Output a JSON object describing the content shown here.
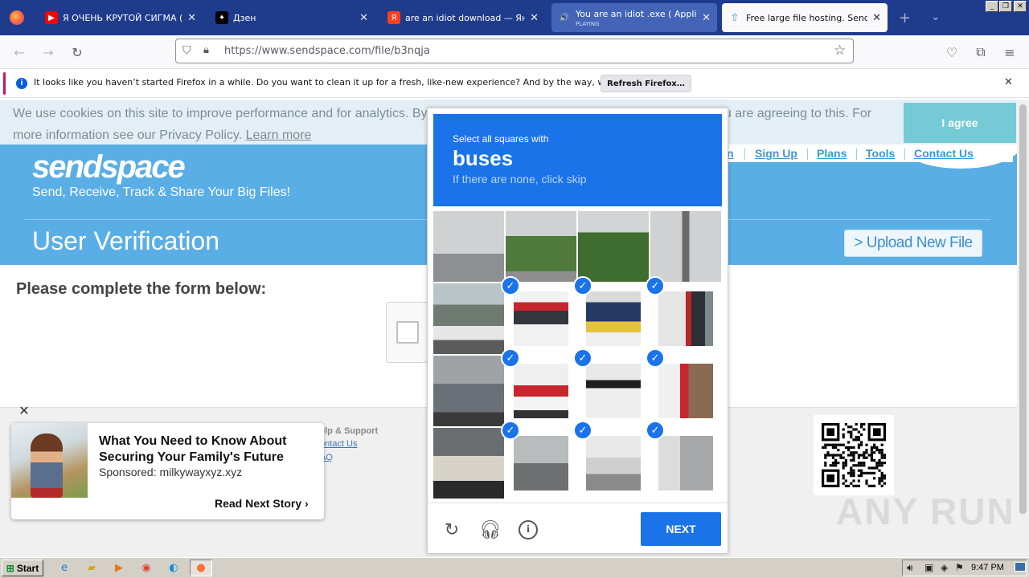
{
  "browser": {
    "tabs": [
      {
        "label": "Я ОЧЕНЬ КРУТОЙ СИГМА (PHONK)",
        "icon": "youtube-icon",
        "color": "#ff0000"
      },
      {
        "label": "Дзен",
        "icon": "dzen-icon",
        "color": "#000000"
      },
      {
        "label": "are an idiot download — Яндекс",
        "icon": "yandex-icon",
        "color": "#fc3f1d"
      },
      {
        "label": "You are an idiot .exe ( Application",
        "sublabel": "PLAYING",
        "icon": "speaker-icon",
        "color": "#4464b8"
      },
      {
        "label": "Free large file hosting. Send big",
        "icon": "sendspace-icon",
        "color": "#3a98d6"
      }
    ],
    "url": "https://www.sendspace.com/file/b3nqja",
    "notification": {
      "text": "It looks like you haven’t started Firefox in a while. Do you want to clean it up for a fresh, like-new experience? And by the way, welcome back!",
      "button": "Refresh Firefox…"
    }
  },
  "cookie": {
    "text": "We use cookies on this site to improve performance and for analytics. By browsing this site, or clicking the ‘I agree’ button, you are agreeing to this. For more information see our Privacy Policy.",
    "learn_more": "Learn more",
    "agree": "I agree"
  },
  "site": {
    "logo": "sendspace",
    "tagline": "Send, Receive, Track & Share Your Big Files!",
    "nav": [
      "n",
      "Sign Up",
      "Plans",
      "Tools",
      "Contact Us"
    ],
    "page_title": "User Verification",
    "upload_button": "> Upload New File",
    "form_heading": "Please complete the form below:",
    "footer": {
      "heading": "elp & Support",
      "links": [
        "ontact Us",
        "AQ"
      ]
    }
  },
  "ad": {
    "title": "What You Need to Know About Securing Your Family's Future",
    "sponsor": "Sponsored: milkywayxyz.xyz",
    "cta": "Read Next Story"
  },
  "captcha": {
    "instruction": "Select all squares with",
    "target": "buses",
    "hint": "If there are none, click skip",
    "selected": [
      5,
      6,
      7,
      9,
      10,
      11,
      13,
      14,
      15
    ],
    "next": "NEXT"
  },
  "watermark": "ANY RUN",
  "taskbar": {
    "start": "Start",
    "time": "9:47 PM"
  }
}
